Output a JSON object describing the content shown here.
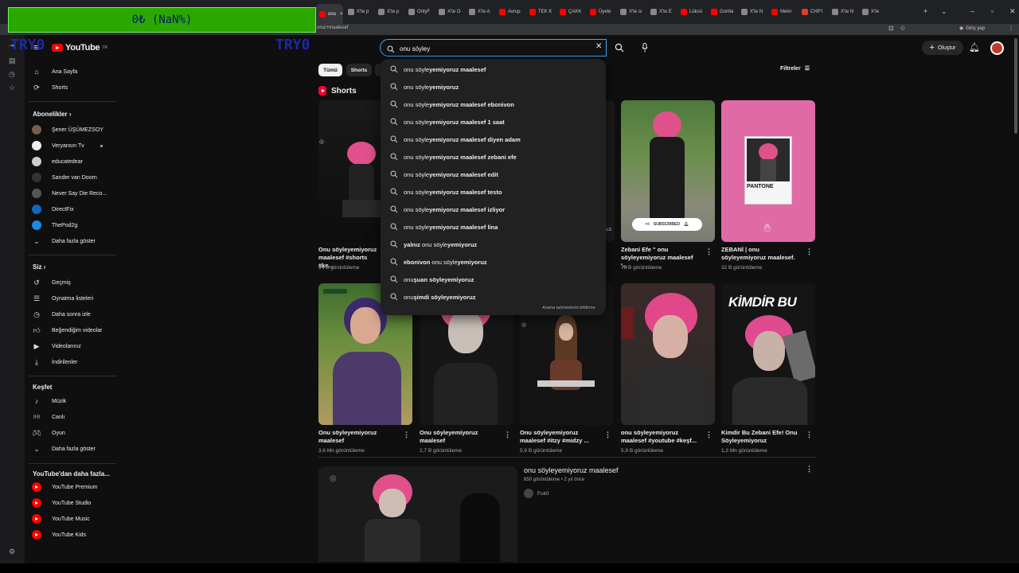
{
  "browser": {
    "active_tab": "onu",
    "tabs": [
      {
        "label": "X'te p",
        "color": "#888"
      },
      {
        "label": "X'te p",
        "color": "#888"
      },
      {
        "label": "OnlyF",
        "color": "#888"
      },
      {
        "label": "X'te O",
        "color": "#888"
      },
      {
        "label": "X'te A",
        "color": "#888"
      },
      {
        "label": "Avrup",
        "color": "#ff0000"
      },
      {
        "label": "TEK K",
        "color": "#ff0000"
      },
      {
        "label": "ÇAKK",
        "color": "#ff0000"
      },
      {
        "label": "Üyele",
        "color": "#ff0000"
      },
      {
        "label": "X'te sı",
        "color": "#888"
      },
      {
        "label": "X'te E",
        "color": "#888"
      },
      {
        "label": "Lüksü",
        "color": "#ff0000"
      },
      {
        "label": "Gorilla",
        "color": "#ff0000"
      },
      {
        "label": "X'te N",
        "color": "#888"
      },
      {
        "label": "Melvi",
        "color": "#ff0000"
      },
      {
        "label": "CHP'l",
        "color": "#e53935"
      },
      {
        "label": "X'te N",
        "color": "#888"
      },
      {
        "label": "X'te",
        "color": "#888"
      }
    ],
    "url_fragment": "oruz+maalesef",
    "login_label": "Giriş yap"
  },
  "overlay": {
    "text": "0₺ (NaN%)",
    "watermark_left": "TRY0",
    "watermark_right": "TRY0"
  },
  "header": {
    "logo_text": "YouTube",
    "logo_tm": "TR",
    "search_value": "onu söyley",
    "create_label": "Oluştur"
  },
  "sidebar": {
    "main": [
      {
        "label": "Ana Sayfa",
        "icon": "home-icon"
      },
      {
        "label": "Shorts",
        "icon": "shorts-icon"
      }
    ],
    "subs_heading": "Abonelikler",
    "subs": [
      {
        "label": "Şener ÜŞÜMEZSOY",
        "color": "#7a5d4b"
      },
      {
        "label": "Veryansın Tv",
        "color": "#eeeeee",
        "live": true
      },
      {
        "label": "educatedear",
        "color": "#cccccc"
      },
      {
        "label": "Sander van Doorn",
        "color": "#333333"
      },
      {
        "label": "Never Say Die Reco...",
        "color": "#555555"
      },
      {
        "label": "DirectFix",
        "color": "#1565c0"
      },
      {
        "label": "ThePod2g",
        "color": "#1e88e5"
      }
    ],
    "subs_more": "Daha fazla göster",
    "you_heading": "Siz",
    "you": [
      {
        "label": "Geçmiş",
        "icon": "history-icon"
      },
      {
        "label": "Oynatma listeleri",
        "icon": "playlist-icon"
      },
      {
        "label": "Daha sonra izle",
        "icon": "watch-later-icon"
      },
      {
        "label": "Beğendiğim videolar",
        "icon": "like-icon"
      },
      {
        "label": "Videolarınız",
        "icon": "your-videos-icon"
      },
      {
        "label": "İndirilenler",
        "icon": "download-icon"
      }
    ],
    "explore_heading": "Keşfet",
    "explore": [
      {
        "label": "Müzik",
        "icon": "music-icon"
      },
      {
        "label": "Canlı",
        "icon": "live-icon"
      },
      {
        "label": "Oyun",
        "icon": "gaming-icon"
      },
      {
        "label": "Daha fazla göster",
        "icon": "chevron-down-icon"
      }
    ],
    "more_heading": "YouTube'dan daha fazla...",
    "more": [
      {
        "label": "YouTube Premium"
      },
      {
        "label": "YouTube Studio"
      },
      {
        "label": "YouTube Music"
      },
      {
        "label": "YouTube Kids"
      }
    ]
  },
  "chips": {
    "all": "Tümü",
    "shorts": "Shorts",
    "filters": "Filtreler"
  },
  "shorts_heading": "Shorts",
  "suggestions": [
    {
      "pre": "onu söyle",
      "bold": "yemiyoruz maalesef",
      "post": ""
    },
    {
      "pre": "onu söyle",
      "bold": "yemiyoruz",
      "post": ""
    },
    {
      "pre": "onu söyle",
      "bold": "yemiyoruz maalesef ebonivon",
      "post": ""
    },
    {
      "pre": "onu söyle",
      "bold": "yemiyoruz maalesef 1 saat",
      "post": ""
    },
    {
      "pre": "onu söyle",
      "bold": "yemiyoruz maalesef diyen adam",
      "post": ""
    },
    {
      "pre": "onu söyle",
      "bold": "yemiyoruz maalesef zebani efe",
      "post": ""
    },
    {
      "pre": "onu söyle",
      "bold": "yemiyoruz maalesef edit",
      "post": ""
    },
    {
      "pre": "onu söyle",
      "bold": "yemiyoruz maalesef testo",
      "post": ""
    },
    {
      "pre": "onu söyle",
      "bold": "yemiyoruz maalesef izliyor",
      "post": ""
    },
    {
      "pre": "onu söyle",
      "bold": "yemiyoruz maalesef lina",
      "post": ""
    },
    {
      "pre": "",
      "bold": "yalnız ",
      "post": "onu söyle",
      "bold2": "yemiyoruz"
    },
    {
      "pre": "",
      "bold": "ebonivon ",
      "post": "onu söyle",
      "bold2": "yemiyoruz"
    },
    {
      "pre": "onu ",
      "bold": "şuan söyleyemiyoruz",
      "post": ""
    },
    {
      "pre": "onu ",
      "bold": "şimdi söyleyemiyoruz",
      "post": ""
    }
  ],
  "suggest_report": "Arama tahminlerini bildirme",
  "shorts_row1": [
    {
      "title": "Onu söyleyemiyoruz maalesef #shorts #ke...",
      "views": "94 B görüntüleme"
    },
    {
      "title": "Zebani Efe \" onu söyleyemiyoruz maalesef '...",
      "views": "75 B görüntüleme"
    },
    {
      "title": "ZEBANİ | onu söyleyemiyoruz maalesef.",
      "views": "32 B görüntüleme"
    }
  ],
  "shorts_row2": [
    {
      "title": "Onu söyleyemiyoruz maalesef",
      "views": "3,6 Mn görüntüleme"
    },
    {
      "title": "Onu söyleyemiyoruz maalesef",
      "views": "2,7 B görüntüleme"
    },
    {
      "title": "Onu söyleyemiyoruz maalesef #itzy #midzy ...",
      "views": "5,9 B görüntüleme"
    },
    {
      "title": "onu söyleyemiyoruz maalesef #youtube #keşf...",
      "views": "5,9 B görüntüleme"
    },
    {
      "title": "Kimdir Bu Zebani Efe! Onu Söyleyemiyoruz",
      "views": "1,3 Mn görüntüleme"
    }
  ],
  "thumb_text": {
    "kimdir": "KİMDİR BU",
    "pantone": "PANTONE",
    "subscribed": "SUBSCRIBED"
  },
  "video": {
    "title": "onu söyleyemiyoruz maalesef",
    "meta": "850 görüntüleme • 2 yıl önce",
    "channel": "Fuk0"
  }
}
